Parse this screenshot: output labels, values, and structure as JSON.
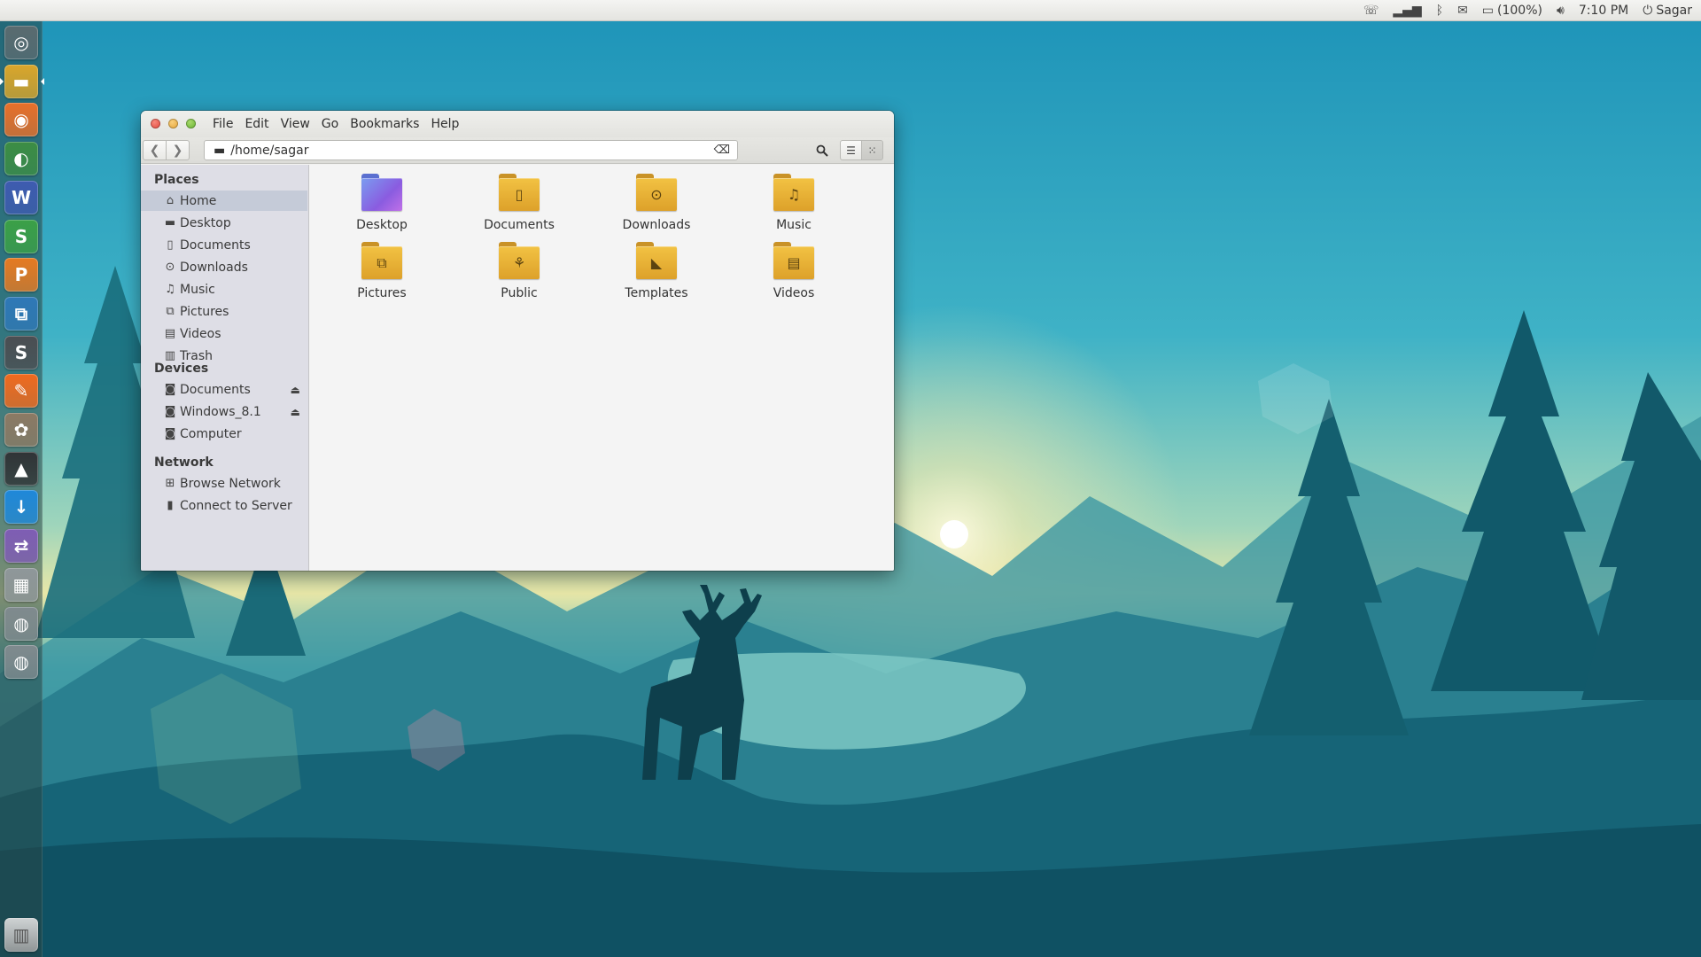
{
  "panel": {
    "battery": "(100%)",
    "time": "7:10 PM",
    "user": "Sagar"
  },
  "launcher": {
    "items": [
      {
        "icon": "ubuntu-dash-icon",
        "glyph": "◎",
        "color": "#5a6b70"
      },
      {
        "icon": "files-icon",
        "glyph": "▬",
        "color": "#d9a62b"
      },
      {
        "icon": "firefox-icon",
        "glyph": "◉",
        "color": "#e8702a"
      },
      {
        "icon": "chrome-icon",
        "glyph": "◐",
        "color": "#3c8d44"
      },
      {
        "icon": "writer-icon",
        "glyph": "W",
        "color": "#3e5bb0"
      },
      {
        "icon": "spreadsheet-icon",
        "glyph": "S",
        "color": "#3ba047"
      },
      {
        "icon": "presentation-icon",
        "glyph": "P",
        "color": "#e57a22"
      },
      {
        "icon": "screenshot-app-icon",
        "glyph": "⧉",
        "color": "#2f78b7"
      },
      {
        "icon": "sublime-text-icon",
        "glyph": "S",
        "color": "#4b4e52"
      },
      {
        "icon": "orange-app-icon",
        "glyph": "✎",
        "color": "#ef6a1e"
      },
      {
        "icon": "gimp-icon",
        "glyph": "✿",
        "color": "#8c7a64"
      },
      {
        "icon": "inkscape-icon",
        "glyph": "▲",
        "color": "#303436"
      },
      {
        "icon": "download-manager-icon",
        "glyph": "↓",
        "color": "#1f88d9"
      },
      {
        "icon": "settings-toggle-icon",
        "glyph": "⇄",
        "color": "#7f5db4"
      },
      {
        "icon": "workspace-switcher-icon",
        "glyph": "▦",
        "color": "#8f979a"
      },
      {
        "icon": "drive-icon",
        "glyph": "◍",
        "color": "#7f8a8e"
      },
      {
        "icon": "drive-icon-2",
        "glyph": "◍",
        "color": "#7f8a8e"
      }
    ],
    "trash_glyph": "▥"
  },
  "window": {
    "menus": [
      "File",
      "Edit",
      "View",
      "Go",
      "Bookmarks",
      "Help"
    ],
    "location": "/home/sagar"
  },
  "sidebar": {
    "places_heading": "Places",
    "places": [
      {
        "label": "Home",
        "icon": "home-icon",
        "glyph": "⌂",
        "selected": true
      },
      {
        "label": "Desktop",
        "icon": "desktop-folder-icon",
        "glyph": "▬"
      },
      {
        "label": "Documents",
        "icon": "document-icon",
        "glyph": "▯"
      },
      {
        "label": "Downloads",
        "icon": "download-icon",
        "glyph": "⊙"
      },
      {
        "label": "Music",
        "icon": "music-icon",
        "glyph": "♫"
      },
      {
        "label": "Pictures",
        "icon": "pictures-icon",
        "glyph": "⧉"
      },
      {
        "label": "Videos",
        "icon": "video-icon",
        "glyph": "▤"
      },
      {
        "label": "Trash",
        "icon": "trash-icon",
        "glyph": "▥"
      }
    ],
    "devices_heading": "Devices",
    "devices": [
      {
        "label": "Documents",
        "icon": "drive-icon",
        "glyph": "◙",
        "eject": true
      },
      {
        "label": "Windows_8.1",
        "icon": "drive-icon",
        "glyph": "◙",
        "eject": true
      },
      {
        "label": "Computer",
        "icon": "computer-icon",
        "glyph": "◙",
        "eject": false
      }
    ],
    "network_heading": "Network",
    "network": [
      {
        "label": "Browse Network",
        "icon": "network-icon",
        "glyph": "⊞"
      },
      {
        "label": "Connect to Server",
        "icon": "server-icon",
        "glyph": "▮"
      }
    ]
  },
  "files": [
    {
      "label": "Desktop",
      "icon": "desktop-folder-icon",
      "glyph": ""
    },
    {
      "label": "Documents",
      "icon": "documents-folder-icon",
      "glyph": "▯"
    },
    {
      "label": "Downloads",
      "icon": "downloads-folder-icon",
      "glyph": "⊙"
    },
    {
      "label": "Music",
      "icon": "music-folder-icon",
      "glyph": "♫"
    },
    {
      "label": "Pictures",
      "icon": "pictures-folder-icon",
      "glyph": "⧉"
    },
    {
      "label": "Public",
      "icon": "public-folder-icon",
      "glyph": "⚘"
    },
    {
      "label": "Templates",
      "icon": "templates-folder-icon",
      "glyph": "◣"
    },
    {
      "label": "Videos",
      "icon": "videos-folder-icon",
      "glyph": "▤"
    }
  ]
}
